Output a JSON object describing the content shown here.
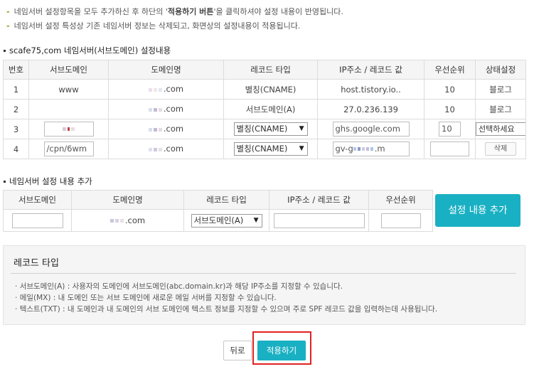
{
  "notes": [
    {
      "pre": "네임서버 설정항목을 모두 추가하신 후 하단의 '",
      "bold": "적용하기 버튼",
      "post": "'을 클릭하셔야 설정 내용이 반영됩니다."
    },
    {
      "pre": "네임서버 설정 특성상 기존 네임서버 정보는 삭제되고, 화면상의 설정내용이 적용됩니다.",
      "bold": "",
      "post": ""
    }
  ],
  "section1_title": "scafe75,com 네임서버(서브도메인) 설정내용",
  "table_headers": [
    "번호",
    "서브도메인",
    "도메인명",
    "레코드 타입",
    "IP주소 / 레코드 값",
    "우선순위",
    "상태설정"
  ],
  "rows": [
    {
      "no": "1",
      "sub": "www",
      "domain": ".com",
      "type": "별칭(CNAME)",
      "value": "host.tistory.io..",
      "priority": "10",
      "status": "블로그"
    },
    {
      "no": "2",
      "sub": "",
      "domain": ".com",
      "type": "서브도메인(A)",
      "value": "27.0.236.139",
      "priority": "10",
      "status": "블로그"
    },
    {
      "no": "3",
      "sub": "",
      "domain": ".com",
      "type": "별칭(CNAME)",
      "value": "ghs.google.com",
      "priority": "10",
      "status": "선택하세요"
    },
    {
      "no": "4",
      "sub": "/cpn/6wm",
      "domain": ".com",
      "type": "별칭(CNAME)",
      "value_start": "gv-g",
      "value_end": ".m",
      "priority": "",
      "status": "삭제"
    }
  ],
  "section2_title": "네임서버 설정 내용 추가",
  "add_headers": [
    "서브도메인",
    "도메인명",
    "레코드 타입",
    "IP주소 / 레코드 값",
    "우선순위"
  ],
  "add_row": {
    "domain": ".com",
    "type": "서브도메인(A)"
  },
  "add_button": "설정 내용 추가",
  "info": {
    "title": "레코드 타입",
    "items": [
      "서브도메인(A) : 사용자의 도메인에 서브도메인(abc.domain.kr)과 해당 IP주소를 지정할 수 있습니다.",
      "메일(MX) : 내 도메인 또는 서브 도메인에 새로운 메일 서버를 지정할 수 있습니다.",
      "텍스트(TXT) : 내 도메인과 내 도메인의 서브 도메인에 텍스트 정보를 지정할 수 있으며 주로 SPF 레코드 값을 입력하는데 사용됩니다."
    ]
  },
  "buttons": {
    "back": "뒤로",
    "apply": "적용하기"
  },
  "colors": {
    "accent": "#1ab0c3",
    "highlight": "#e12222",
    "note_dash": "#7aa61a"
  },
  "icons": {
    "dropdown": "triangle-down"
  }
}
